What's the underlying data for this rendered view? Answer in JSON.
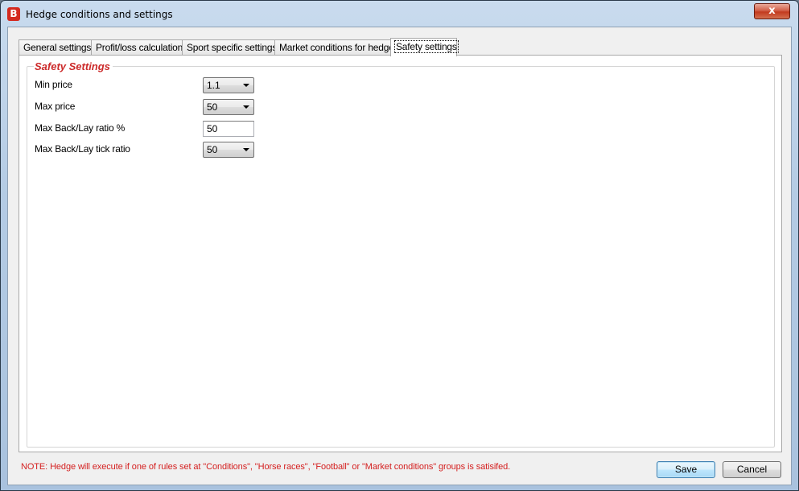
{
  "window": {
    "title": "Hedge conditions and settings",
    "app_icon_letter": "B",
    "close_label": "x"
  },
  "tabs": [
    {
      "label": "General settings",
      "active": false
    },
    {
      "label": "Profit/loss calculation",
      "active": false
    },
    {
      "label": "Sport specific settings",
      "active": false
    },
    {
      "label": "Market conditions for hedge",
      "active": false
    },
    {
      "label": "Safety settings",
      "active": true
    }
  ],
  "safety": {
    "group_title": "Safety Settings",
    "min_price": {
      "label": "Min price",
      "value": "1.1"
    },
    "max_price": {
      "label": "Max price",
      "value": "50"
    },
    "max_back_lay_ratio": {
      "label": "Max Back/Lay ratio %",
      "value": "50"
    },
    "max_back_lay_tick_ratio": {
      "label": "Max Back/Lay tick ratio",
      "value": "50"
    }
  },
  "footer": {
    "note": "NOTE: Hedge will execute if one of rules set at \"Conditions\", \"Horse races\", \"Football\" or \"Market conditions\" groups is satisifed.",
    "save_label": "Save",
    "cancel_label": "Cancel"
  },
  "colors": {
    "accent_red": "#cc2a2a",
    "note_red": "#d41f1f",
    "default_button_border": "#3c7fb1"
  }
}
